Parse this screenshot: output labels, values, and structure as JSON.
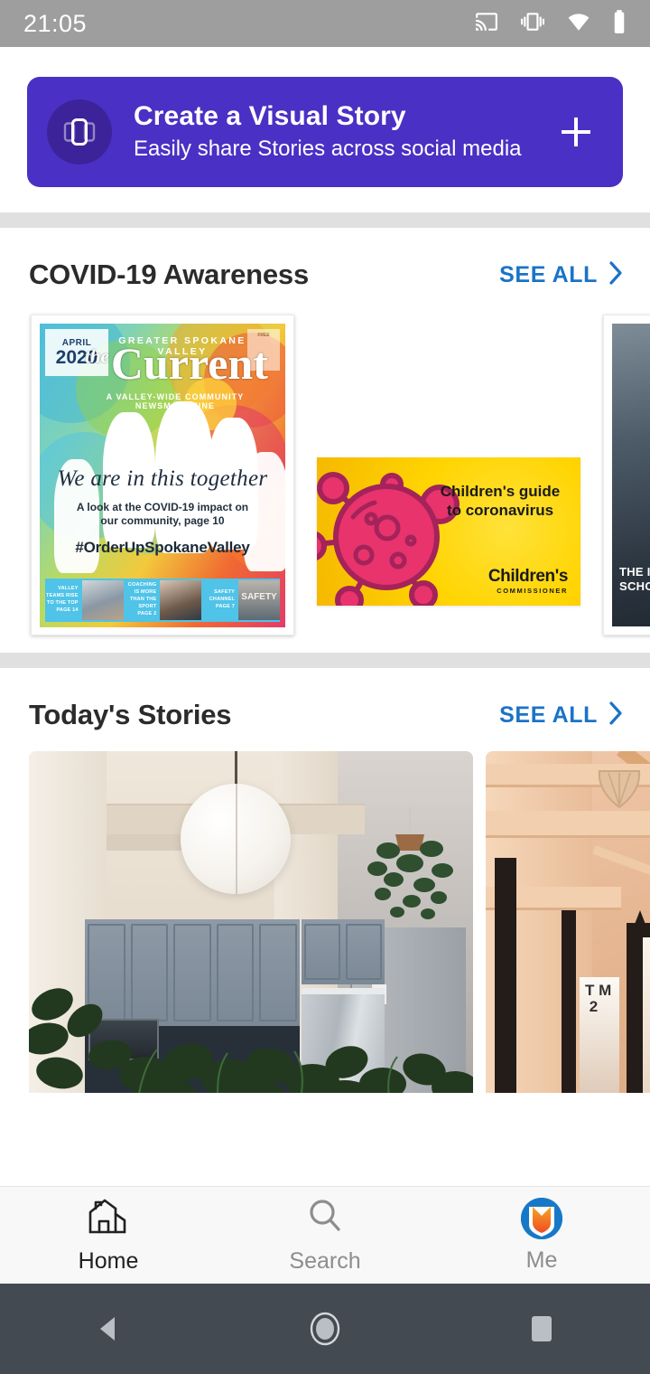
{
  "status_bar": {
    "time": "21:05",
    "icons": [
      "cast-icon",
      "vibrate-icon",
      "wifi-icon",
      "battery-icon"
    ],
    "background": "#9e9e9e"
  },
  "story_banner": {
    "title": "Create a Visual Story",
    "subtitle": "Easily share Stories across social media",
    "icon": "story-carousel-icon",
    "action_icon": "plus-icon",
    "background": "#4A30C4",
    "badge_background": "#3C2399"
  },
  "sections": [
    {
      "title": "COVID-19 Awareness",
      "see_all_label": "SEE ALL",
      "see_all_color": "#1a73c8",
      "cards": [
        {
          "type": "magazine-cover",
          "date_month": "APRIL",
          "date_year": "2020",
          "kicker": "GREATER  SPOKANE  VALLEY",
          "logo_the": "the",
          "logo_name": "Current",
          "tagline": "A VALLEY-WIDE COMMUNITY NEWSMAGAZINE",
          "free_label": "FREE",
          "headline": "We are in this together",
          "subhead": "A look at the COVID-19 impact on our community, page 10",
          "hashtag": "#OrderUpSpokaneValley",
          "strip_items": [
            "VALLEY TEAMS RISE TO THE TOP PAGE 14",
            "COACHING IS MORE THAN THE SPORT PAGE 2",
            "SAFETY CHANNEL PAGE 7"
          ],
          "strip_color": "#4FC3E8"
        },
        {
          "type": "coronavirus-guide",
          "title": "Children's guide to coronavirus",
          "logo_main": "Children's",
          "logo_sub": "COMMISSIONER",
          "background": "#FFD400",
          "virus_color": "#E8336D"
        },
        {
          "type": "dark-cover",
          "text": "THE IMPACT ON AT-RISK YOUTH LOCAL SCHOOLS AND CRISIS CARE"
        }
      ]
    },
    {
      "title": "Today's Stories",
      "see_all_label": "SEE ALL",
      "see_all_color": "#1a73c8",
      "cards": [
        {
          "type": "photo",
          "subject": "kitchen-interior-with-paper-lantern-and-plants"
        },
        {
          "type": "photo",
          "subject": "victorian-shopping-arcade-interior"
        }
      ]
    }
  ],
  "bottom_nav": {
    "items": [
      {
        "label": "Home",
        "icon": "home-icon",
        "active": true
      },
      {
        "label": "Search",
        "icon": "search-icon",
        "active": false
      },
      {
        "label": "Me",
        "icon": "avatar-icon",
        "active": false
      }
    ]
  },
  "android_nav": {
    "back": "back-triangle-icon",
    "home": "home-circle-icon",
    "recents": "recents-square-icon",
    "background": "#434a51"
  }
}
